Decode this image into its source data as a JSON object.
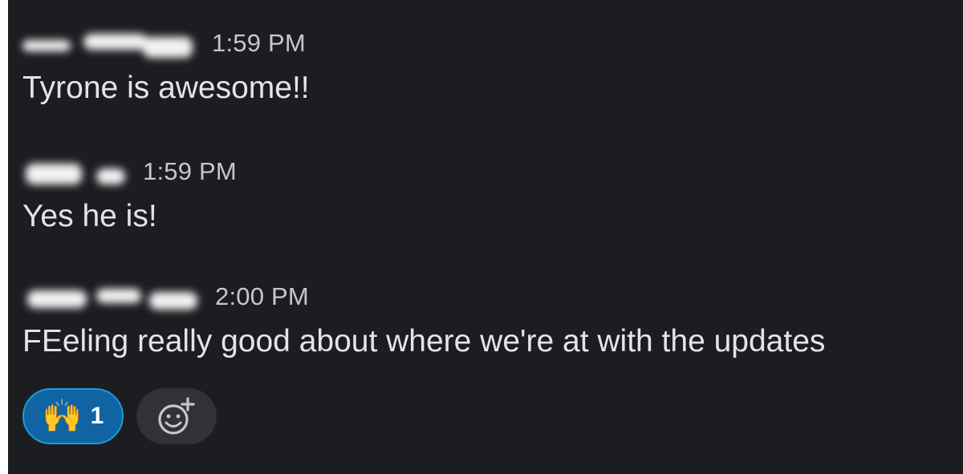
{
  "messages": [
    {
      "time": "1:59 PM",
      "text": "Tyrone is awesome!!"
    },
    {
      "time": "1:59 PM",
      "text": "Yes he is!"
    },
    {
      "time": "2:00 PM",
      "text": "FEeling really good about where we're at with the updates"
    }
  ],
  "reaction": {
    "emoji": "🙌",
    "count": "1"
  },
  "icons": {
    "add_reaction": "add-reaction-icon",
    "reaction_emoji": "raising-hands-icon"
  },
  "colors": {
    "background": "#1b1d21",
    "text": "#e3e4e5",
    "timestamp": "#c6c7c9",
    "reaction_bg": "#1164a3",
    "reaction_border": "#1d9bd1",
    "add_reaction_bg": "#303236"
  }
}
